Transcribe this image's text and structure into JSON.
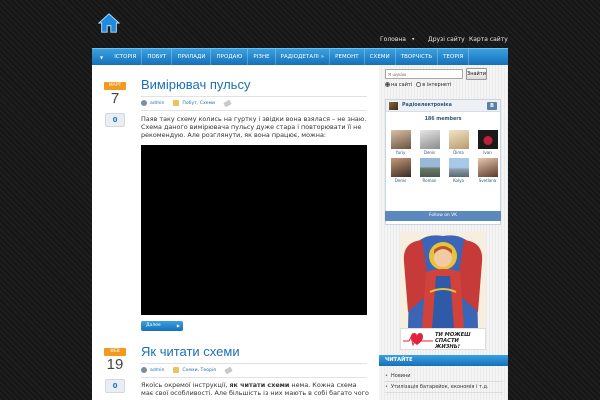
{
  "top_links": {
    "home": "Головна",
    "friends": "Друзі сайту",
    "sitemap": "Карта сайту"
  },
  "nav": {
    "items": [
      "ІСТОРІЯ",
      "ПОБУТ",
      "ПРИЛАДИ",
      "ПРОДАЮ",
      "РІЗНЕ",
      "РАДІОДЕТАЛІ »",
      "РЕМОНТ",
      "СХЕМИ",
      "ТВОРЧІСТЬ",
      "ТЕОРІЯ"
    ]
  },
  "posts": [
    {
      "month": "МАРТ",
      "day": "7",
      "comments": "0",
      "title": "Вимірювач пульсу",
      "author": "admin",
      "categories": "Побут, Схеми",
      "text": "Паяв таку схему колись на гуртку і звідки вона взялася – не знаю. Схема даного вимірювача пульсу дуже стара і повторювати її не рекомендую. Але розглянути, як вона працює, можна:",
      "more": "Далее"
    },
    {
      "month": "ФЕВ",
      "day": "19",
      "comments": "0",
      "title": "Як читати схеми",
      "author": "admin",
      "categories": "Схеми, Теорія",
      "text_before": "Якоїсь окремої інструкції, ",
      "text_bold": "як читати схеми",
      "text_after": " нема. Кожна схема має свої особливості. Але більшість із них мають в собі багато чого"
    }
  ],
  "sidebar": {
    "search": {
      "placeholder": "Я шукаю",
      "button": "Знайти",
      "option_site": "на сайті",
      "option_web": "в інтернеті"
    },
    "vk": {
      "group": "Радіоелектроніка",
      "logo": "B",
      "members_text": "186 members",
      "members": [
        "Yuriy",
        "Denis",
        "Dima",
        "Ivan",
        "Denis",
        "Roman",
        "Kolya",
        "Svetlana"
      ],
      "follow": "Follow on VK"
    },
    "banner": {
      "line1": "ТИ МОЖЕШ",
      "line2": "СПАСТИ ЖИЗНЬ!"
    },
    "reading": {
      "title": "ЧИТАЙТЕ",
      "items": [
        "Новини",
        "Утилізація батарейок, економія і т.д."
      ]
    }
  },
  "colors": {
    "accent": "#1b6fb8",
    "nav_blue": "#2386cc",
    "date_orange": "#f39a1e"
  }
}
